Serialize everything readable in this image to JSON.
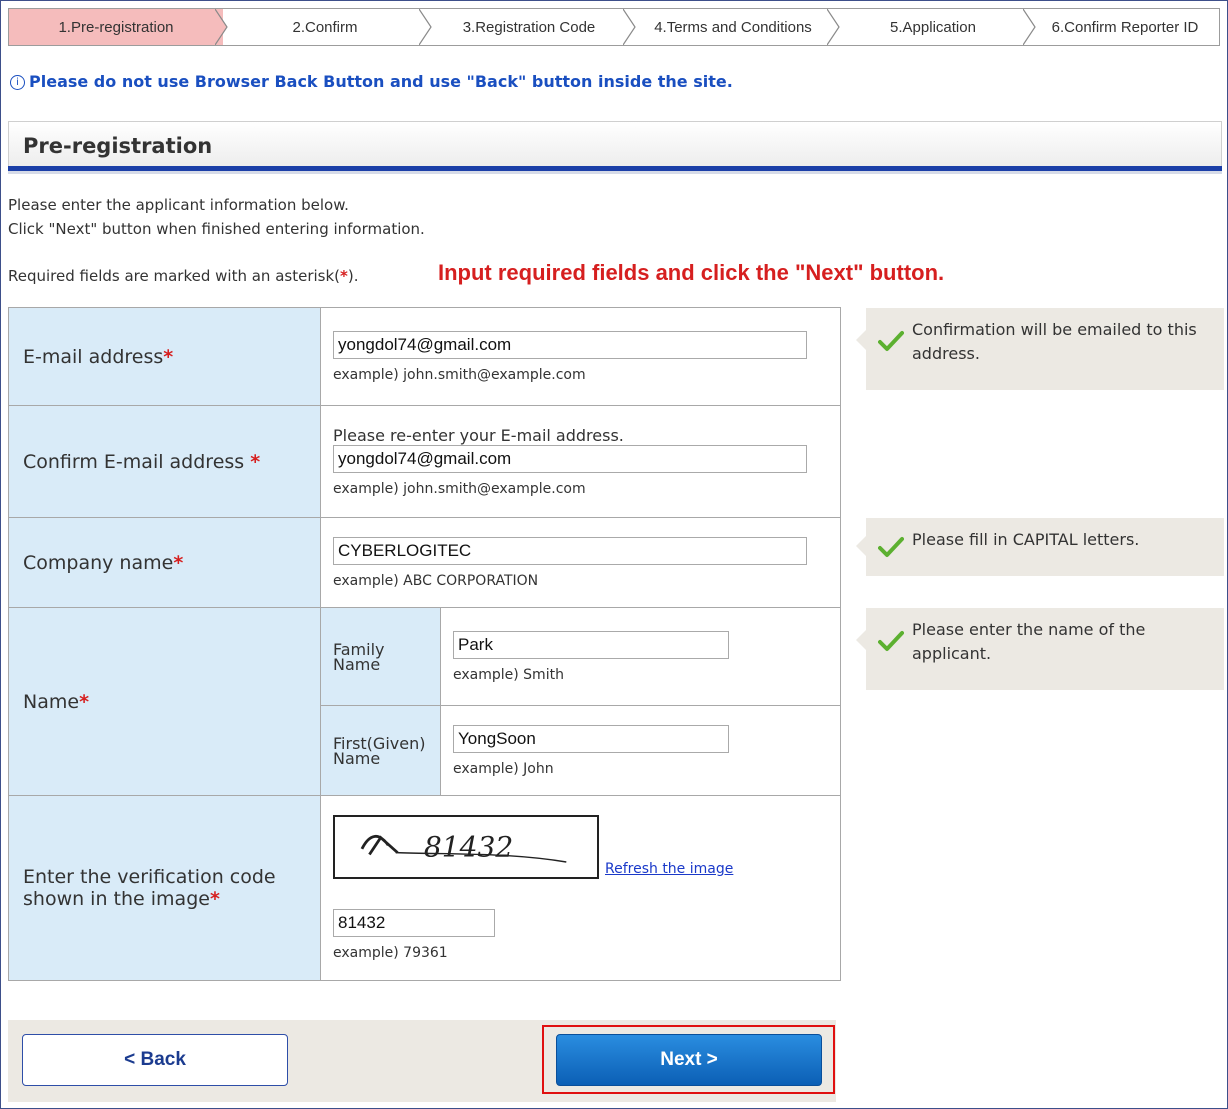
{
  "steps": [
    {
      "label": "1.Pre-registration",
      "active": true
    },
    {
      "label": "2.Confirm",
      "active": false
    },
    {
      "label": "3.Registration Code",
      "active": false
    },
    {
      "label": "4.Terms and Conditions",
      "active": false
    },
    {
      "label": "5.Application",
      "active": false
    },
    {
      "label": "6.Confirm Reporter ID",
      "active": false
    }
  ],
  "notice": "Please do not use Browser Back Button and use \"Back\" button inside the site.",
  "section_title": "Pre-registration",
  "intro_line1": "Please enter the applicant information below.",
  "intro_line2": "Click \"Next\" button when finished entering information.",
  "required_note_prefix": "Required fields are marked with an asterisk(",
  "required_note_suffix": ").",
  "asterisk": "*",
  "callout": "Input required fields and click the \"Next\" button.",
  "form": {
    "email": {
      "label": "E-mail address",
      "value": "yongdol74@gmail.com",
      "example": "example) john.smith@example.com"
    },
    "confirm_email": {
      "label": "Confirm E-mail address ",
      "hint": "Please re-enter your E-mail address.",
      "value": "yongdol74@gmail.com",
      "example": "example) john.smith@example.com"
    },
    "company": {
      "label": "Company name",
      "value": "CYBERLOGITEC",
      "example": "example) ABC CORPORATION"
    },
    "name": {
      "label": "Name",
      "family_label_1": "Family",
      "family_label_2": "Name",
      "family_value": "Park",
      "family_example": "example) Smith",
      "first_label_1": "First(Given)",
      "first_label_2": "Name",
      "first_value": "YongSoon",
      "first_example": "example) John"
    },
    "verification": {
      "label_1": "Enter the verification code",
      "label_2": "shown in the image",
      "refresh": "Refresh the image",
      "value": "81432",
      "example": "example) 79361",
      "captcha_text": "81432"
    }
  },
  "tips": {
    "email": "Confirmation will be emailed to this address.",
    "company": "Please fill in CAPITAL letters.",
    "name": "Please enter the name of the applicant."
  },
  "buttons": {
    "back": "< Back",
    "next": "Next >"
  },
  "colors": {
    "accent_blue": "#1b3fa8",
    "label_bg": "#d9ebf8",
    "required_red": "#d61f1f",
    "active_step": "#f5bcbc"
  }
}
